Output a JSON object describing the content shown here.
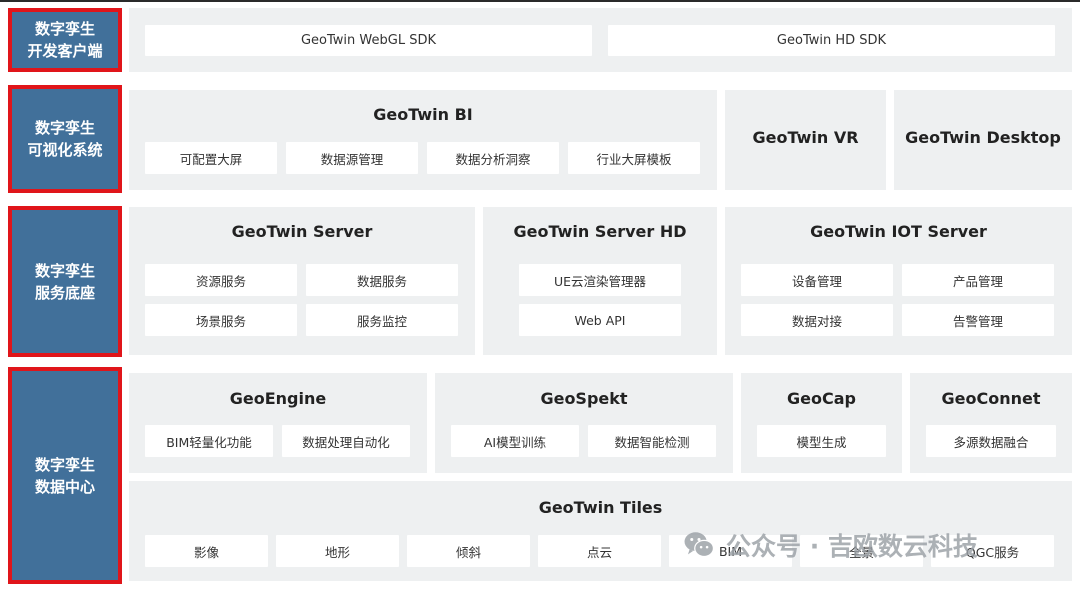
{
  "layers": [
    {
      "label_line1": "数字孪生",
      "label_line2": "开发客户端"
    },
    {
      "label_line1": "数字孪生",
      "label_line2": "可视化系统"
    },
    {
      "label_line1": "数字孪生",
      "label_line2": "服务底座"
    },
    {
      "label_line1": "数字孪生",
      "label_line2": "数据中心"
    }
  ],
  "client": {
    "sdks": [
      "GeoTwin WebGL SDK",
      "GeoTwin HD SDK"
    ]
  },
  "visualization": {
    "bi": {
      "title": "GeoTwin BI",
      "items": [
        "可配置大屏",
        "数据源管理",
        "数据分析洞察",
        "行业大屏模板"
      ]
    },
    "vr": {
      "title": "GeoTwin VR"
    },
    "desktop": {
      "title": "GeoTwin Desktop"
    }
  },
  "services": {
    "server": {
      "title": "GeoTwin Server",
      "items": [
        "资源服务",
        "数据服务",
        "场景服务",
        "服务监控"
      ]
    },
    "server_hd": {
      "title": "GeoTwin Server HD",
      "items": [
        "UE云渲染管理器",
        "Web API"
      ]
    },
    "iot": {
      "title": "GeoTwin IOT Server",
      "items": [
        "设备管理",
        "产品管理",
        "数据对接",
        "告警管理"
      ]
    }
  },
  "data_center": {
    "engine": {
      "title": "GeoEngine",
      "items": [
        "BIM轻量化功能",
        "数据处理自动化"
      ]
    },
    "spekt": {
      "title": "GeoSpekt",
      "items": [
        "AI模型训练",
        "数据智能检测"
      ]
    },
    "cap": {
      "title": "GeoCap",
      "items": [
        "模型生成"
      ]
    },
    "connet": {
      "title": "GeoConnet",
      "items": [
        "多源数据融合"
      ]
    },
    "tiles": {
      "title": "GeoTwin Tiles",
      "items": [
        "影像",
        "地形",
        "倾斜",
        "点云",
        "BIM",
        "全景",
        "QGC服务"
      ]
    }
  },
  "watermark": {
    "text": "公众号 · 吉欧数云科技",
    "icon": "wechat-icon"
  },
  "colors": {
    "sidebar_bg": "#41709a",
    "sidebar_border": "#e0151a",
    "panel_bg": "#eef0f1"
  }
}
